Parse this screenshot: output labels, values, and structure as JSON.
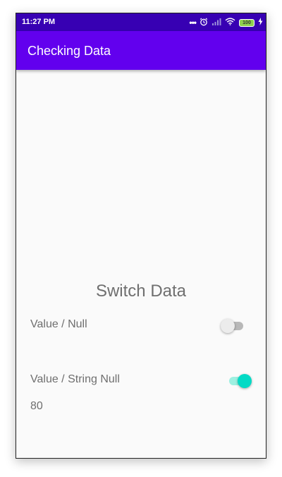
{
  "status_bar": {
    "time": "11:27 PM",
    "battery_level": "100",
    "icons": [
      "more-dots-icon",
      "alarm-icon",
      "signal-icon",
      "wifi-icon",
      "battery-icon",
      "charging-icon"
    ]
  },
  "app_bar": {
    "title": "Checking Data",
    "color": "#6200ee",
    "status_color": "#3700b3"
  },
  "main": {
    "section_title": "Switch Data",
    "rows": [
      {
        "label": "Value / Null",
        "checked": false
      },
      {
        "label": "Value / String Null",
        "checked": true
      }
    ],
    "value_text": "80",
    "accent_color": "#03dac5"
  }
}
